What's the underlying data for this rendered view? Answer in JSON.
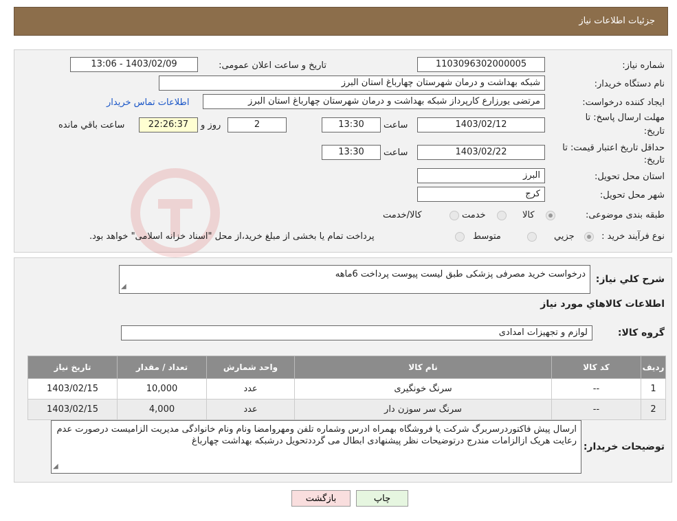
{
  "header": {
    "title": "جزئیات اطلاعات نیاز"
  },
  "form": {
    "need_number_label": "شماره نیاز:",
    "need_number": "1103096302000005",
    "announce_label": "تاریخ و ساعت اعلان عمومی:",
    "announce_value": "1403/02/09 - 13:06",
    "buyer_org_label": "نام دستگاه خریدار:",
    "buyer_org": "شبکه بهداشت و درمان شهرستان چهارباغ استان البرز",
    "requester_label": "ایجاد کننده درخواست:",
    "requester": "مرتضی یورزارع کارپرداز شبکه بهداشت و درمان شهرستان چهارباغ استان البرز",
    "contact_link": "اطلاعات تماس خریدار",
    "deadline_label_1": "مهلت ارسال پاسخ: تا",
    "deadline_label_2": "تاریخ:",
    "deadline_date": "1403/02/12",
    "time_label": "ساعت",
    "deadline_time": "13:30",
    "days_value": "2",
    "days_label": "روز و",
    "remaining_value": "22:26:37",
    "remaining_label": "ساعت باقي مانده",
    "validity_label_1": "حداقل تاریخ اعتبار قیمت: تا",
    "validity_label_2": "تاریخ:",
    "validity_date": "1403/02/22",
    "validity_time": "13:30",
    "province_label": "استان محل تحویل:",
    "province": "البرز",
    "city_label": "شهر محل تحویل:",
    "city": "کرج",
    "category_label": "طبقه بندی موضوعی:",
    "category_options": [
      "کالا",
      "خدمت",
      "کالا/خدمت"
    ],
    "process_label": "نوع فرآیند خرید :",
    "process_options": [
      "جزیي",
      "متوسط"
    ],
    "process_note": "پرداخت تمام یا بخشی از مبلغ خرید،از محل \"اسناد خزانه اسلامی\" خواهد بود."
  },
  "details": {
    "description_label": "شرح کلي نياز:",
    "description": "درخواست خرید مصرفی پزشکی طبق لیست پیوست پرداخت 6ماهه",
    "goods_info_title": "اطلاعات کالاهاي مورد نياز",
    "group_label": "گروه کالا:",
    "group_value": "لوازم و تجهیزات امدادی",
    "table": {
      "headers": [
        "رديف",
        "کد کالا",
        "نام کالا",
        "واحد شمارش",
        "تعداد / مقدار",
        "تاریخ نیاز"
      ],
      "rows": [
        [
          "1",
          "--",
          "سرنگ خونگیری",
          "عدد",
          "10,000",
          "1403/02/15"
        ],
        [
          "2",
          "--",
          "سرنگ سر سوزن دار",
          "عدد",
          "4,000",
          "1403/02/15"
        ]
      ]
    },
    "buyer_notes_label": "توضیحات خریدار:",
    "buyer_notes": "ارسال پیش فاکتوردرسربرگ شرکت یا فروشگاه بهمراه ادرس وشماره تلفن ومهروامضا ونام ونام خانوادگی مدیریت الزامیست درصورت عدم رعایت هریک ازالزامات مندرج درتوضیحات نظر پیشنهادی ابطال می گرددتحویل درشبکه بهداشت چهارباغ"
  },
  "buttons": {
    "print": "چاپ",
    "back": "بازگشت"
  },
  "colors": {
    "header": "#8c6e4b",
    "link": "#1a56c7",
    "back_button": "#f9dede",
    "print_button": "#e6f6e0"
  }
}
